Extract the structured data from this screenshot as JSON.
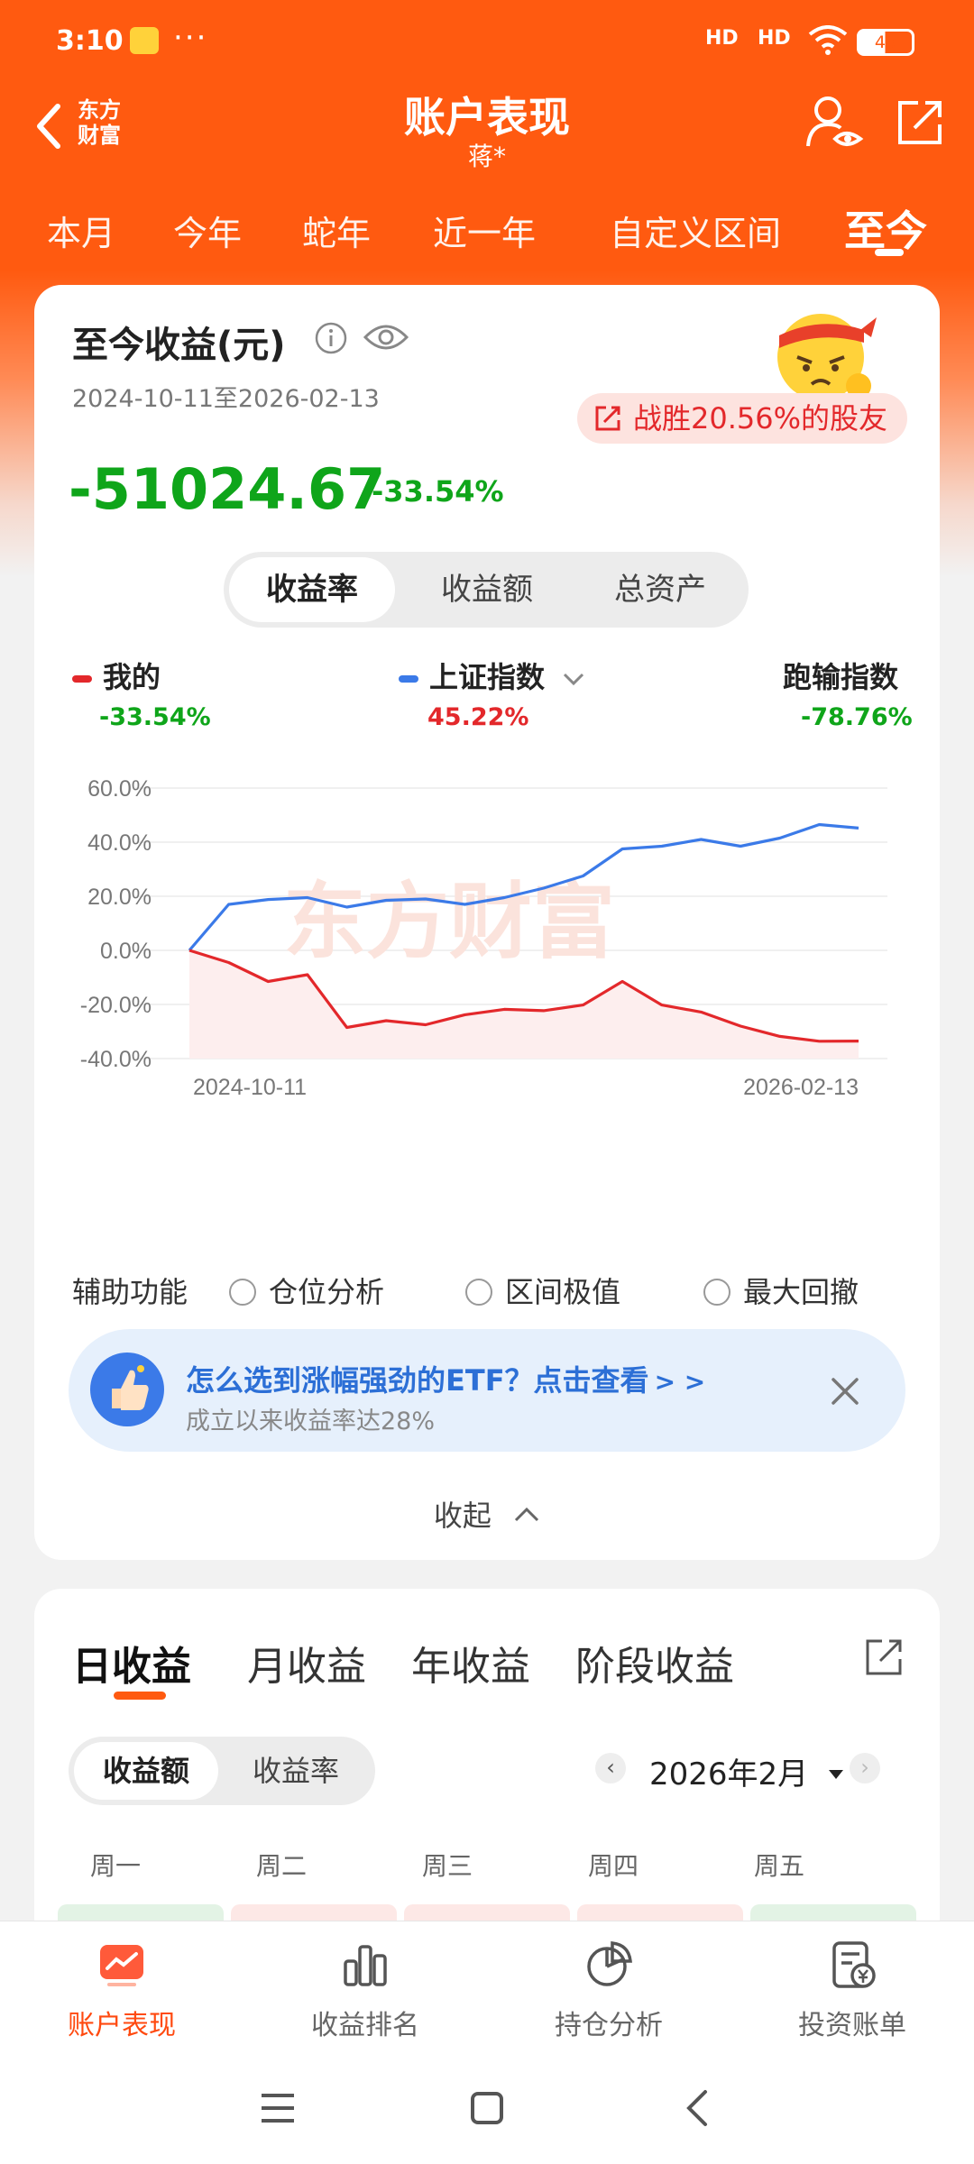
{
  "status_bar": {
    "time": "3:10",
    "dots": "···",
    "net1": "HD",
    "net2": "HD",
    "battery": "49"
  },
  "header": {
    "title": "账户表现",
    "subtitle": "蒋*",
    "logo_text": "东方\n财富"
  },
  "period_tabs": [
    {
      "label": "本月",
      "active": false
    },
    {
      "label": "今年",
      "active": false
    },
    {
      "label": "蛇年",
      "active": false
    },
    {
      "label": "近一年",
      "active": false
    },
    {
      "label": "自定义区间",
      "active": false
    },
    {
      "label": "至今",
      "active": true
    }
  ],
  "summary": {
    "title": "至今收益(元)",
    "date_range": "2024-10-11至2026-02-13",
    "beat_text": "战胜20.56%的股友",
    "value": "-51024.67",
    "percent": "-33.54%"
  },
  "metric_tabs": [
    {
      "label": "收益率",
      "active": true
    },
    {
      "label": "收益额",
      "active": false
    },
    {
      "label": "总资产",
      "active": false
    }
  ],
  "legend": [
    {
      "name": "我的",
      "value": "-33.54%",
      "color": "#e3282b",
      "value_color": "#0fa51a"
    },
    {
      "name": "上证指数",
      "value": "45.22%",
      "color": "#3b7ae8",
      "value_color": "#e3282b",
      "dropdown": true
    },
    {
      "name": "跑输指数",
      "value": "-78.76%",
      "value_color": "#0fa51a"
    }
  ],
  "chart_data": {
    "type": "line",
    "watermark": "东方财富",
    "x_start": "2024-10-11",
    "x_end": "2026-02-13",
    "y_ticks": [
      "60.0%",
      "40.0%",
      "20.0%",
      "0.0%",
      "-20.0%",
      "-40.0%"
    ],
    "ylim": [
      -40,
      60
    ],
    "grid": true,
    "series": [
      {
        "name": "上证指数",
        "color": "#3b7ae8",
        "values": [
          0,
          17,
          18.8,
          19.5,
          16,
          18.5,
          19,
          17,
          19.5,
          23,
          27.5,
          37.5,
          38.5,
          41,
          38.5,
          41.5,
          46.5,
          45.2
        ]
      },
      {
        "name": "我的",
        "color": "#e3282b",
        "values": [
          0,
          -4.5,
          -11.5,
          -9,
          -28.5,
          -26,
          -27.5,
          -23.8,
          -21.8,
          -22.3,
          -20.2,
          -11.5,
          -20.2,
          -22.8,
          -28,
          -31.8,
          -33.6,
          -33.54
        ]
      }
    ]
  },
  "aux": {
    "label": "辅助功能",
    "options": [
      "仓位分析",
      "区间极值",
      "最大回撤"
    ]
  },
  "promo": {
    "title": "怎么选到涨幅强劲的ETF？点击查看",
    "arrows": "> >",
    "subtitle": "成立以来收益率达28%"
  },
  "collapse_label": "收起",
  "returns": {
    "tabs": [
      {
        "label": "日收益",
        "active": true
      },
      {
        "label": "月收益",
        "active": false
      },
      {
        "label": "年收益",
        "active": false
      },
      {
        "label": "阶段收益",
        "active": false
      }
    ],
    "toggle": [
      {
        "label": "收益额",
        "active": true
      },
      {
        "label": "收益率",
        "active": false
      }
    ],
    "month": "2026年2月",
    "prev": "‹",
    "next": "›",
    "weekdays": [
      "周一",
      "周二",
      "周三",
      "周四",
      "周五"
    ],
    "cell_colors": [
      "#e3f3e5",
      "#fde8e6",
      "#fde8e6",
      "#fde8e6",
      "#e3f3e5"
    ]
  },
  "bottom_nav": [
    {
      "label": "账户表现",
      "icon": "chart-trend-icon",
      "active": true
    },
    {
      "label": "收益排名",
      "icon": "bar-chart-icon",
      "active": false
    },
    {
      "label": "持仓分析",
      "icon": "pie-chart-icon",
      "active": false
    },
    {
      "label": "投资账单",
      "icon": "bill-icon",
      "active": false
    }
  ]
}
